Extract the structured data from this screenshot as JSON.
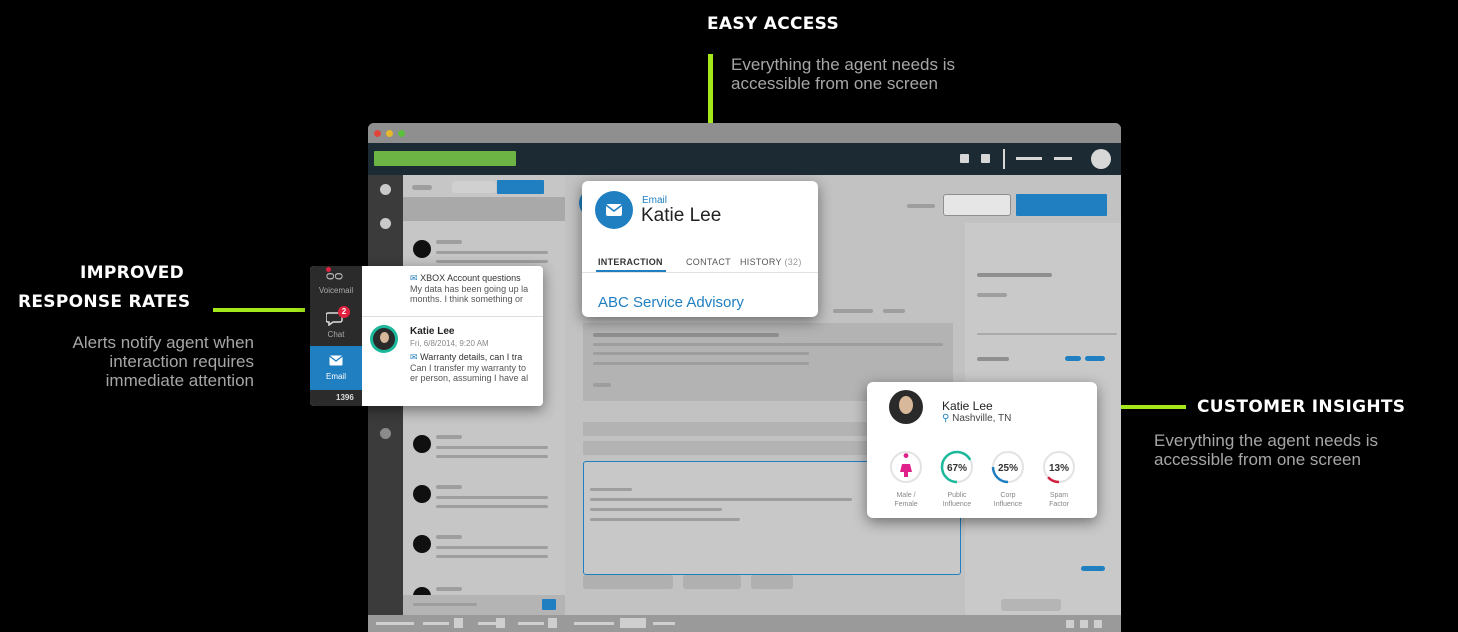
{
  "callouts": {
    "easy_access": {
      "title": "EASY ACCESS",
      "desc_line1": "Everything the agent needs is",
      "desc_line2": "accessible from one screen"
    },
    "response_rates": {
      "title_line1": "IMPROVED",
      "title_line2": "RESPONSE RATES",
      "desc_line1": "Alerts notify agent when",
      "desc_line2": "interaction requires",
      "desc_line3": "immediate attention"
    },
    "customer_insights": {
      "title": "CUSTOMER INSIGHTS",
      "desc_line1": "Everything the agent needs is",
      "desc_line2": "accessible from one screen"
    }
  },
  "email_card": {
    "type_label": "Email",
    "name": "Katie Lee",
    "tabs": [
      "INTERACTION",
      "CONTACT",
      "HISTORY"
    ],
    "history_count": "(32)",
    "subject": "ABC Service Advisory"
  },
  "alerts_panel": {
    "channels": [
      {
        "label": "Voicemail"
      },
      {
        "label": "Chat",
        "badge": "2"
      },
      {
        "label": "Email"
      }
    ],
    "counter": "1396",
    "messages": [
      {
        "subject": "XBOX Account questions",
        "body_line1": "My data has been going up la",
        "body_line2": "months. I think something or"
      },
      {
        "sender": "Katie Lee",
        "time": "Fri, 6/8/2014, 9:20 AM",
        "subject": "Warranty details, can I tra",
        "body_line1": "Can I transfer my warranty to",
        "body_line2": "er person, assuming I have al"
      }
    ]
  },
  "insights_card": {
    "name": "Katie Lee",
    "location": "Nashville, TN",
    "metrics": [
      {
        "label_line1": "Male /",
        "label_line2": "Female",
        "value": "",
        "fraction": 0,
        "color": "#e0218a"
      },
      {
        "label_line1": "Public",
        "label_line2": "Influence",
        "value": "67%",
        "fraction": 0.67,
        "color": "#1bb89c"
      },
      {
        "label_line1": "Corp",
        "label_line2": "Influence",
        "value": "25%",
        "fraction": 0.25,
        "color": "#1f7fc1"
      },
      {
        "label_line1": "Spam",
        "label_line2": "Factor",
        "value": "13%",
        "fraction": 0.13,
        "color": "#d0213f"
      }
    ]
  },
  "colors": {
    "accent_green": "#a4e81b",
    "brand_blue": "#1f7fc1",
    "dark_bar": "#1c2a33"
  }
}
